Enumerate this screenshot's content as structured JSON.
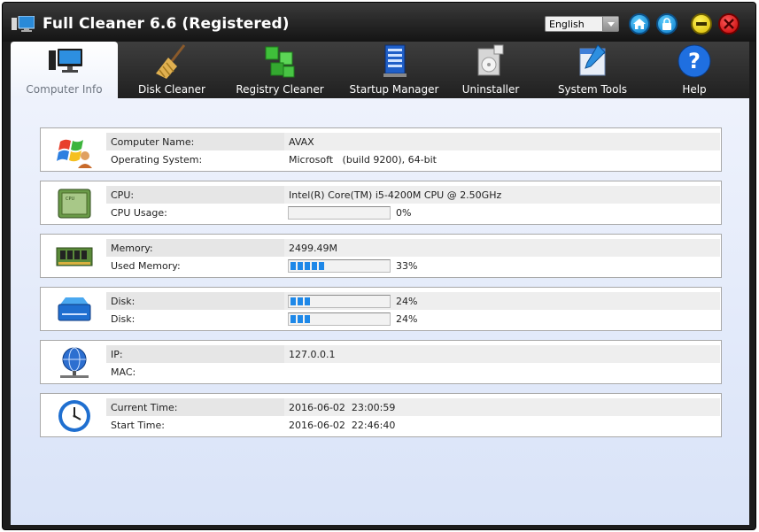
{
  "window": {
    "title": "Full Cleaner 6.6 (Registered)"
  },
  "language": {
    "selected": "English"
  },
  "tabs": [
    {
      "label": "Computer Info",
      "icon": "computer-icon",
      "active": true
    },
    {
      "label": "Disk Cleaner",
      "icon": "broom-icon"
    },
    {
      "label": "Registry Cleaner",
      "icon": "registry-cubes-icon"
    },
    {
      "label": "Startup Manager",
      "icon": "startup-list-icon"
    },
    {
      "label": "Uninstaller",
      "icon": "uninstaller-box-icon"
    },
    {
      "label": "System Tools",
      "icon": "system-tools-icon"
    },
    {
      "label": "Help",
      "icon": "help-icon"
    }
  ],
  "info": {
    "system": {
      "computer_name_label": "Computer Name:",
      "computer_name": "AVAX",
      "os_label": "Operating System:",
      "os": "Microsoft   (build 9200), 64-bit"
    },
    "cpu": {
      "cpu_label": "CPU:",
      "cpu": "Intel(R) Core(TM) i5-4200M CPU @ 2.50GHz",
      "usage_label": "CPU Usage:",
      "usage_text": "0%",
      "usage_fraction": 0.0
    },
    "memory": {
      "memory_label": "Memory:",
      "memory": "2499.49M",
      "used_label": "Used Memory:",
      "used_text": "33%",
      "used_fraction": 0.33
    },
    "disk": {
      "disk1_label": "Disk:",
      "disk1_text": "24%",
      "disk1_fraction": 0.24,
      "disk2_label": "Disk:",
      "disk2_text": "24%",
      "disk2_fraction": 0.24
    },
    "network": {
      "ip_label": "IP:",
      "ip": "127.0.0.1",
      "mac_label": "MAC:",
      "mac": ""
    },
    "time": {
      "current_label": "Current Time:",
      "current": "2016-06-02  23:00:59",
      "start_label": "Start Time:",
      "start": "2016-06-02  22:46:40"
    }
  },
  "colors": {
    "accent": "#1e88e8",
    "titlebar": "#1c1c1c",
    "content_bg": "#e3eaf9"
  }
}
